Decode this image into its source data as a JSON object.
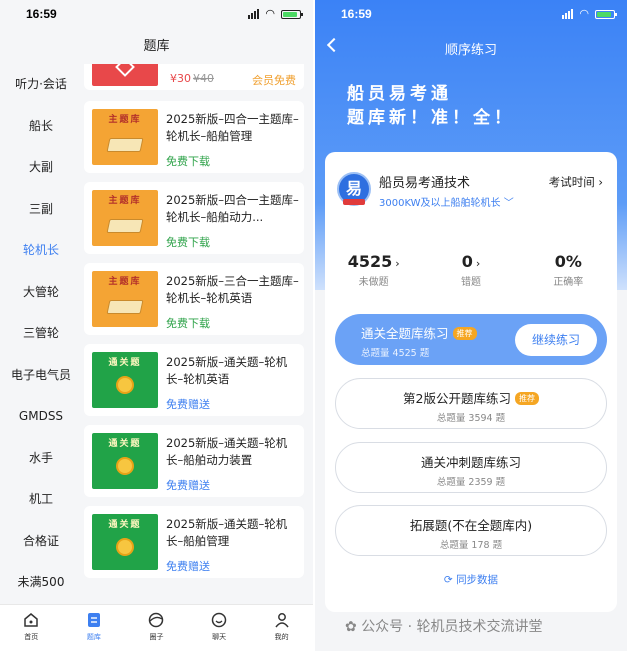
{
  "left": {
    "status_time": "16:59",
    "title": "题库",
    "sidebar": [
      {
        "label": "听力·会话",
        "active": false
      },
      {
        "label": "船长",
        "active": false
      },
      {
        "label": "大副",
        "active": false
      },
      {
        "label": "三副",
        "active": false
      },
      {
        "label": "轮机长",
        "active": true
      },
      {
        "label": "大管轮",
        "active": false
      },
      {
        "label": "三管轮",
        "active": false
      },
      {
        "label": "电子电气员",
        "active": false
      },
      {
        "label": "GMDSS",
        "active": false
      },
      {
        "label": "水手",
        "active": false
      },
      {
        "label": "机工",
        "active": false
      },
      {
        "label": "合格证",
        "active": false
      },
      {
        "label": "未满500",
        "active": false
      }
    ],
    "top_card": {
      "price": "¥30",
      "old_price": "¥40",
      "member_label": "会员免费"
    },
    "cards": [
      {
        "thumb": "主题库",
        "thumb_color": "#f4a434",
        "title": "2025新版–四合一主题库–轮机长–船舶管理",
        "tag": "免费下载",
        "tag_color": "#2fa34a"
      },
      {
        "thumb": "主题库",
        "thumb_color": "#f4a434",
        "title": "2025新版–四合一主题库–轮机长–船舶动力...",
        "tag": "免费下载",
        "tag_color": "#2fa34a"
      },
      {
        "thumb": "主题库",
        "thumb_color": "#f4a434",
        "title": "2025新版–三合一主题库–轮机长–轮机英语",
        "tag": "免费下载",
        "tag_color": "#2fa34a"
      },
      {
        "thumb": "通关题",
        "thumb_color": "#21a348",
        "title": "2025新版–通关题–轮机长–轮机英语",
        "tag": "免费赠送",
        "tag_color": "#3d7ff0"
      },
      {
        "thumb": "通关题",
        "thumb_color": "#21a348",
        "title": "2025新版–通关题–轮机长–船舶动力装置",
        "tag": "免费赠送",
        "tag_color": "#3d7ff0"
      },
      {
        "thumb": "通关题",
        "thumb_color": "#21a348",
        "title": "2025新版–通关题–轮机长–船舶管理",
        "tag": "免费赠送",
        "tag_color": "#3d7ff0"
      }
    ],
    "tabs": [
      {
        "label": "首页",
        "icon": "home-icon",
        "active": false
      },
      {
        "label": "题库",
        "icon": "question-bank-icon",
        "active": true
      },
      {
        "label": "圈子",
        "icon": "circle-icon",
        "active": false
      },
      {
        "label": "聊天",
        "icon": "chat-icon",
        "active": false
      },
      {
        "label": "我的",
        "icon": "profile-icon",
        "active": false
      }
    ]
  },
  "right": {
    "status_time": "16:59",
    "title": "顺序练习",
    "banner_line1": "船员易考通",
    "banner_line2": "题库新！准！全！",
    "brand": "船员易考通技术",
    "brand_sub": "3000KW及以上船舶轮机长",
    "logo_char": "易",
    "exam_time": "考试时间",
    "stats": [
      {
        "value": "4525",
        "label": "未做题",
        "arrow": "›"
      },
      {
        "value": "0",
        "label": "错题",
        "arrow": "›"
      },
      {
        "value": "0%",
        "label": "正确率",
        "arrow": ""
      }
    ],
    "practices": [
      {
        "name": "通关全题库练习",
        "badge": "推荐",
        "count": "总题量 4525 题"
      },
      {
        "name": "第2版公开题库练习",
        "badge": "推荐",
        "count": "总题量 3594 题"
      },
      {
        "name": "通关冲刺题库练习",
        "badge": "",
        "count": "总题量 2359 题"
      },
      {
        "name": "拓展题(不在全题库内)",
        "badge": "",
        "count": "总题量 178 题"
      }
    ],
    "continue_label": "继续练习",
    "sync_label": "同步数据",
    "watermark": "公众号 · 轮机员技术交流讲堂"
  },
  "colors": {
    "accent": "#3d7ff0",
    "green": "#2fa34a",
    "orange": "#f4a434",
    "red": "#e8484a"
  }
}
